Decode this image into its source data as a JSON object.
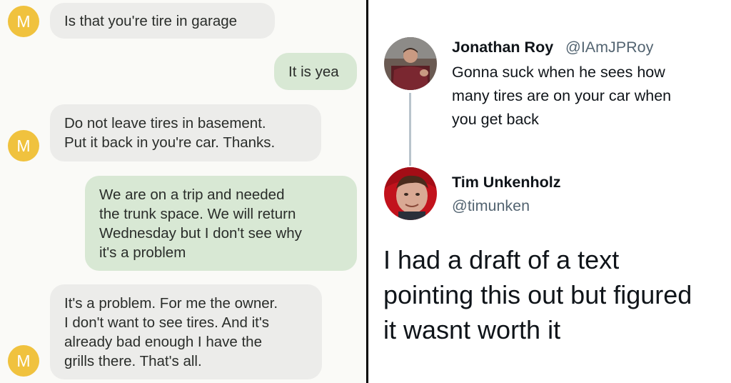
{
  "sms": {
    "sender_initial": "M",
    "messages": [
      {
        "direction": "incoming",
        "lines": [
          "Is that you're tire in garage"
        ]
      },
      {
        "direction": "outgoing",
        "lines": [
          "It is yea"
        ]
      },
      {
        "direction": "incoming",
        "lines": [
          "Do not leave tires in basement.",
          "Put it back in you're car. Thanks."
        ]
      },
      {
        "direction": "outgoing",
        "lines": [
          "We are on a trip and needed",
          "the trunk space. We will return",
          "Wednesday but I don't see why",
          "it's a problem"
        ]
      },
      {
        "direction": "incoming",
        "lines": [
          "It's a problem. For me the owner.",
          "I don't want to see tires. And it's",
          "already bad enough I have the",
          "grills there. That's all."
        ]
      }
    ]
  },
  "tweets": [
    {
      "name": "Jonathan Roy",
      "handle": "@IAmJPRoy",
      "lines": [
        "Gonna suck when he sees how",
        "many tires are on your car when",
        "you get back"
      ]
    },
    {
      "name": "Tim Unkenholz",
      "handle": "@timunken",
      "lines": [
        "I had a draft of a text",
        "pointing this out but figured",
        "it wasnt worth it"
      ]
    }
  ],
  "colors": {
    "incoming_bubble": "#ececea",
    "outgoing_bubble": "#d8e8d4",
    "avatar": "#f0c23e",
    "thread_line": "#b9c4cc"
  }
}
